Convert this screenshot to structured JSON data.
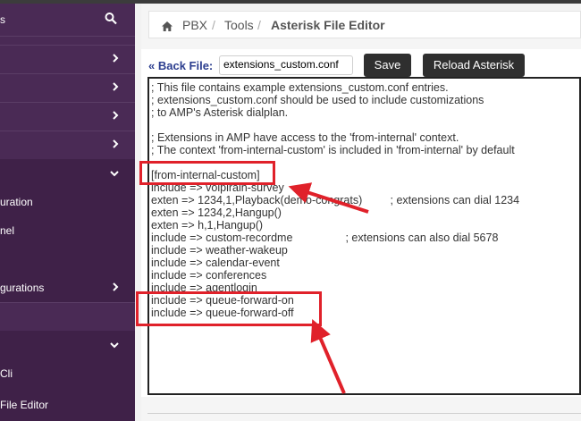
{
  "sidebar": {
    "items": [
      {
        "label": "s",
        "icon": "search-icon"
      },
      {
        "label": "",
        "icon": "chevron-right-icon"
      },
      {
        "label": "",
        "icon": "chevron-right-icon"
      },
      {
        "label": "",
        "icon": "chevron-right-icon"
      },
      {
        "label": "",
        "icon": "chevron-right-icon"
      },
      {
        "label": "",
        "icon": "chevron-down-icon"
      },
      {
        "label": "uration"
      },
      {
        "label": "nel"
      },
      {
        "label": ""
      },
      {
        "label": "gurations",
        "icon": "chevron-right-icon"
      },
      {
        "label": ""
      },
      {
        "label": "",
        "icon": "chevron-down-icon"
      },
      {
        "label": "Cli"
      },
      {
        "label": "File Editor"
      }
    ]
  },
  "breadcrumb": {
    "home_icon": "home-icon",
    "items": [
      "PBX",
      "Tools",
      "Asterisk File Editor"
    ],
    "separator": "/"
  },
  "toolbar": {
    "back_label": "« Back File:",
    "file_value": "extensions_custom.conf",
    "save_label": "Save",
    "reload_label": "Reload Asterisk"
  },
  "editor": {
    "lines": [
      "; This file contains example extensions_custom.conf entries.",
      "; extensions_custom.conf should be used to include customizations",
      "; to AMP's Asterisk dialplan.",
      "",
      "; Extensions in AMP have access to the 'from-internal' context.",
      "; The context 'from-internal-custom' is included in 'from-internal' by default",
      "",
      "[from-internal-custom]",
      "include => voiplrain-survey",
      "exten => 1234,1,Playback(demo-congrats)         ; extensions can dial 1234",
      "exten => 1234,2,Hangup()",
      "exten => h,1,Hangup()",
      "include => custom-recordme                 ; extensions can also dial 5678",
      "include => weather-wakeup",
      "include => calendar-event",
      "include => conferences",
      "include => agentlogin",
      "include => queue-forward-on",
      "include => queue-forward-off"
    ]
  },
  "colors": {
    "sidebar_bg": "#4a2a55",
    "annotation_red": "#e0212a",
    "button_bg": "#2f2f2f",
    "link_blue": "#2c3e8f"
  }
}
